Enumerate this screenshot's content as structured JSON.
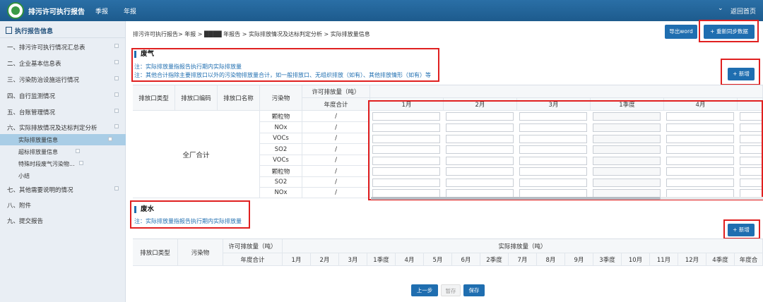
{
  "header": {
    "app_title": "排污许可执行报告",
    "nav": [
      "季报",
      "年报"
    ],
    "dropdown_glyph": "⌄",
    "home_link": "返回首页"
  },
  "sidebar": {
    "title": "执行报告信息",
    "items": [
      "一、排污许可执行情况汇总表",
      "二、企业基本信息表",
      "三、污染防治设施运行情况",
      "四、自行监测情况",
      "五、台账管理情况",
      "六、实际排放情况及达标判定分析",
      "七、其他需要说明的情况",
      "八、附件",
      "九、提交报告"
    ],
    "subitems": [
      "实际排放量信息",
      "超标排放量信息",
      "特殊时段废气污染物...",
      "小结"
    ]
  },
  "breadcrumb": "排污许可执行报告> 年报 > ████ 年报告 > 实际排放情况及达标判定分析 > 实际排放量信息",
  "toolbar": {
    "export_label": "导出word",
    "sync_label": "+ 重新同步数据"
  },
  "gas": {
    "title": "废气",
    "notes": [
      "注：实际排放量指报告执行期内实际排放量",
      "注：其他合计指除主要排放口以外的污染物排放量合计，如一般排放口、无组织排放（如有）、其他排放情形（如有）等"
    ],
    "add_label": "+ 新增",
    "headers": {
      "outlet_type": "排放口类型",
      "outlet_code": "排放口编码",
      "outlet_name": "排放口名称",
      "pollutant": "污染物",
      "permit": "许可排放量（吨）",
      "annual": "年度合计",
      "months": [
        "1月",
        "2月",
        "3月",
        "1季度",
        "4月"
      ]
    },
    "group_label": "全厂合计",
    "rows": [
      {
        "pollutant": "颗粒物",
        "annual": "/"
      },
      {
        "pollutant": "NOx",
        "annual": "/"
      },
      {
        "pollutant": "VOCs",
        "annual": "/"
      },
      {
        "pollutant": "SO2",
        "annual": "/"
      },
      {
        "pollutant": "VOCs",
        "annual": "/"
      },
      {
        "pollutant": "颗粒物",
        "annual": "/"
      },
      {
        "pollutant": "SO2",
        "annual": "/"
      },
      {
        "pollutant": "NOx",
        "annual": "/"
      }
    ]
  },
  "water": {
    "title": "废水",
    "note": "注：实际排放量指报告执行期内实际排放量",
    "add_label": "+ 新增",
    "headers": {
      "outlet_type": "排放口类型",
      "pollutant": "污染物",
      "permit": "许可排放量（吨）",
      "annual": "年度合计",
      "actual": "实际排放量（吨）",
      "periods": [
        "1月",
        "2月",
        "3月",
        "1季度",
        "4月",
        "5月",
        "6月",
        "2季度",
        "7月",
        "8月",
        "9月",
        "3季度",
        "10月",
        "11月",
        "12月",
        "4季度",
        "年度合"
      ]
    }
  },
  "footer": {
    "prev_label": "上一步",
    "draft_label": "暂存",
    "save_label": "保存"
  }
}
